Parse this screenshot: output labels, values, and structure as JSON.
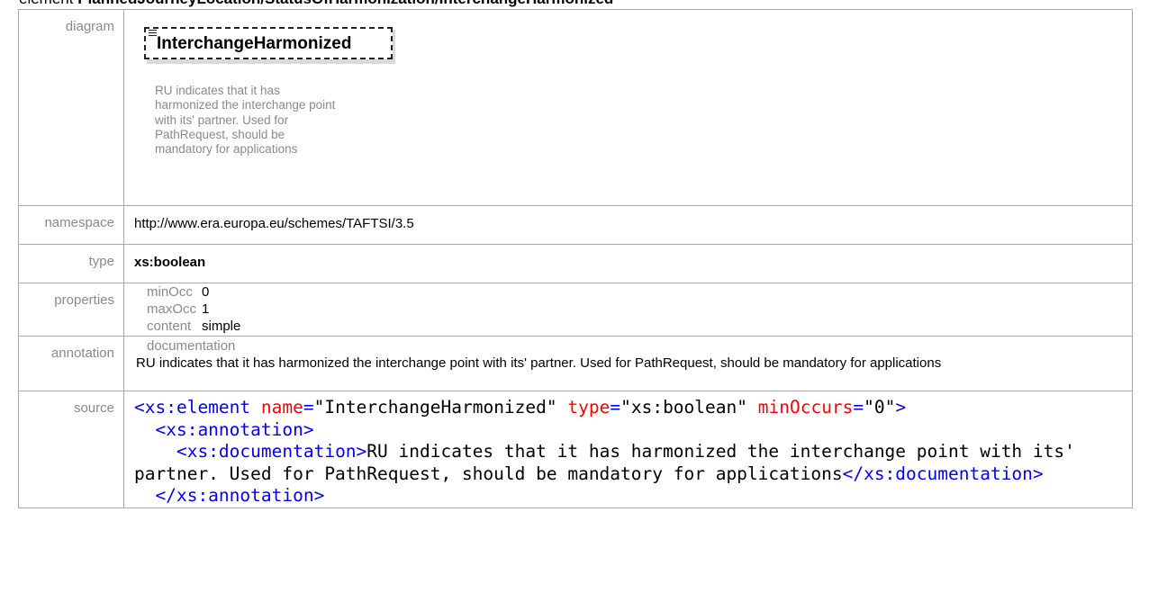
{
  "header": {
    "prefix": "element ",
    "path": "PlannedJourneyLocation/StatusOfHarmonization/InterchangeHarmonized"
  },
  "labels": {
    "diagram": "diagram",
    "namespace": "namespace",
    "type": "type",
    "properties": "properties",
    "annotation": "annotation",
    "source": "source"
  },
  "diagram": {
    "element_name": "InterchangeHarmonized",
    "element_icon": "element-doc-icon",
    "doc_lines": [
      "RU indicates that it has",
      "harmonized the interchange point",
      "with its' partner. Used for",
      "PathRequest, should be",
      "mandatory for applications"
    ]
  },
  "namespace": "http://www.era.europa.eu/schemes/TAFTSI/3.5",
  "type": "xs:boolean",
  "properties": [
    {
      "key": "minOcc",
      "value": "0"
    },
    {
      "key": "maxOcc",
      "value": "1"
    },
    {
      "key": "content",
      "value": "simple"
    }
  ],
  "annotation": {
    "heading": "documentation",
    "text": "RU indicates that it has harmonized the interchange point with its' partner. Used for PathRequest, should be mandatory for applications"
  },
  "source": {
    "open_tag": "<xs:element",
    "attr_name": "name",
    "attr_name_val": "\"InterchangeHarmonized\"",
    "attr_type": "type",
    "attr_type_val": "\"xs:boolean\"",
    "attr_min": "minOccurs",
    "attr_min_val": "\"0\"",
    "close_bracket": ">",
    "annotation_open": "<xs:annotation>",
    "documentation_open": "<xs:documentation>",
    "documentation_text": "RU indicates that it has harmonized the interchange point with its' partner. Used for PathRequest, should be mandatory for applications",
    "documentation_close": "</xs:documentation>",
    "annotation_close": "</xs:annotation>"
  },
  "colors": {
    "tag": "#0000ff",
    "element_name": "#990000",
    "attribute": "#ff0000",
    "border": "#a9a9a9",
    "label": "#8a8a8a"
  }
}
